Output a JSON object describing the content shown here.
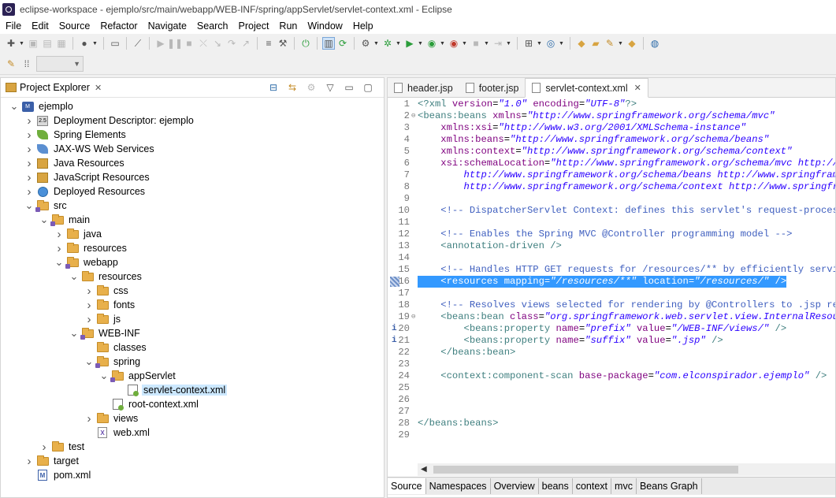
{
  "window": {
    "title": "eclipse-workspace - ejemplo/src/main/webapp/WEB-INF/spring/appServlet/servlet-context.xml - Eclipse"
  },
  "menubar": [
    "File",
    "Edit",
    "Source",
    "Refactor",
    "Navigate",
    "Search",
    "Project",
    "Run",
    "Window",
    "Help"
  ],
  "explorer": {
    "tab_label": "Project Explorer",
    "close_glyph": "✕",
    "tree": [
      {
        "label": "ejemplo",
        "depth": 0,
        "twisty": "open",
        "icon": "project"
      },
      {
        "label": "Deployment Descriptor: ejemplo",
        "depth": 1,
        "twisty": "closed",
        "icon": "dd"
      },
      {
        "label": "Spring Elements",
        "depth": 1,
        "twisty": "closed",
        "icon": "leaf"
      },
      {
        "label": "JAX-WS Web Services",
        "depth": 1,
        "twisty": "closed",
        "icon": "ws"
      },
      {
        "label": "Java Resources",
        "depth": 1,
        "twisty": "closed",
        "icon": "jar"
      },
      {
        "label": "JavaScript Resources",
        "depth": 1,
        "twisty": "closed",
        "icon": "jar"
      },
      {
        "label": "Deployed Resources",
        "depth": 1,
        "twisty": "closed",
        "icon": "globe"
      },
      {
        "label": "src",
        "depth": 1,
        "twisty": "open",
        "icon": "pkgfolder"
      },
      {
        "label": "main",
        "depth": 2,
        "twisty": "open",
        "icon": "pkgfolder"
      },
      {
        "label": "java",
        "depth": 3,
        "twisty": "closed",
        "icon": "folder"
      },
      {
        "label": "resources",
        "depth": 3,
        "twisty": "closed",
        "icon": "folder"
      },
      {
        "label": "webapp",
        "depth": 3,
        "twisty": "open",
        "icon": "pkgfolder"
      },
      {
        "label": "resources",
        "depth": 4,
        "twisty": "open",
        "icon": "folder"
      },
      {
        "label": "css",
        "depth": 5,
        "twisty": "closed",
        "icon": "folder"
      },
      {
        "label": "fonts",
        "depth": 5,
        "twisty": "closed",
        "icon": "folder"
      },
      {
        "label": "js",
        "depth": 5,
        "twisty": "closed",
        "icon": "folder"
      },
      {
        "label": "WEB-INF",
        "depth": 4,
        "twisty": "open",
        "icon": "pkgfolder"
      },
      {
        "label": "classes",
        "depth": 5,
        "twisty": "none",
        "icon": "folder"
      },
      {
        "label": "spring",
        "depth": 5,
        "twisty": "open",
        "icon": "pkgfolder"
      },
      {
        "label": "appServlet",
        "depth": 6,
        "twisty": "open",
        "icon": "pkgfolder"
      },
      {
        "label": "servlet-context.xml",
        "depth": 7,
        "twisty": "none",
        "icon": "springcfg",
        "selected": true
      },
      {
        "label": "root-context.xml",
        "depth": 6,
        "twisty": "none",
        "icon": "springcfg"
      },
      {
        "label": "views",
        "depth": 5,
        "twisty": "closed",
        "icon": "folder"
      },
      {
        "label": "web.xml",
        "depth": 5,
        "twisty": "none",
        "icon": "xml"
      },
      {
        "label": "test",
        "depth": 2,
        "twisty": "closed",
        "icon": "folder"
      },
      {
        "label": "target",
        "depth": 1,
        "twisty": "closed",
        "icon": "folder"
      },
      {
        "label": "pom.xml",
        "depth": 1,
        "twisty": "none",
        "icon": "mfile"
      }
    ]
  },
  "editor": {
    "tabs": [
      {
        "label": "header.jsp",
        "active": false
      },
      {
        "label": "footer.jsp",
        "active": false
      },
      {
        "label": "servlet-context.xml",
        "active": true
      }
    ],
    "lines": [
      {
        "n": "1",
        "fold": "",
        "tokens": [
          [
            "pi",
            "<?xml "
          ],
          [
            "attr",
            "version"
          ],
          [
            "plain",
            "="
          ],
          [
            "val",
            "\"1.0\""
          ],
          [
            "plain",
            " "
          ],
          [
            "attr",
            "encoding"
          ],
          [
            "plain",
            "="
          ],
          [
            "val",
            "\"UTF-8\""
          ],
          [
            "pi",
            "?>"
          ]
        ]
      },
      {
        "n": "2",
        "fold": "⊖",
        "tokens": [
          [
            "tag",
            "<beans:beans "
          ],
          [
            "attr",
            "xmlns"
          ],
          [
            "plain",
            "="
          ],
          [
            "val",
            "\"http://www.springframework.org/schema/mvc\""
          ]
        ]
      },
      {
        "n": "3",
        "fold": "",
        "tokens": [
          [
            "plain",
            "    "
          ],
          [
            "attr",
            "xmlns:xsi"
          ],
          [
            "plain",
            "="
          ],
          [
            "val",
            "\"http://www.w3.org/2001/XMLSchema-instance\""
          ]
        ]
      },
      {
        "n": "4",
        "fold": "",
        "tokens": [
          [
            "plain",
            "    "
          ],
          [
            "attr",
            "xmlns:beans"
          ],
          [
            "plain",
            "="
          ],
          [
            "val",
            "\"http://www.springframework.org/schema/beans\""
          ]
        ]
      },
      {
        "n": "5",
        "fold": "",
        "tokens": [
          [
            "plain",
            "    "
          ],
          [
            "attr",
            "xmlns:context"
          ],
          [
            "plain",
            "="
          ],
          [
            "val",
            "\"http://www.springframework.org/schema/context\""
          ]
        ]
      },
      {
        "n": "6",
        "fold": "",
        "tokens": [
          [
            "plain",
            "    "
          ],
          [
            "attr",
            "xsi:schemaLocation"
          ],
          [
            "plain",
            "="
          ],
          [
            "val",
            "\"http://www.springframework.org/schema/mvc http://www"
          ]
        ]
      },
      {
        "n": "7",
        "fold": "",
        "tokens": [
          [
            "plain",
            "        "
          ],
          [
            "val",
            "http://www.springframework.org/schema/beans http://www.springframewo"
          ]
        ]
      },
      {
        "n": "8",
        "fold": "",
        "tokens": [
          [
            "plain",
            "        "
          ],
          [
            "val",
            "http://www.springframework.org/schema/context http://www.springframe"
          ]
        ]
      },
      {
        "n": "9",
        "fold": "",
        "tokens": []
      },
      {
        "n": "10",
        "fold": "",
        "tokens": [
          [
            "plain",
            "    "
          ],
          [
            "com",
            "<!-- DispatcherServlet Context: defines this servlet's request-processin"
          ]
        ]
      },
      {
        "n": "11",
        "fold": "",
        "tokens": []
      },
      {
        "n": "12",
        "fold": "",
        "tokens": [
          [
            "plain",
            "    "
          ],
          [
            "com",
            "<!-- Enables the Spring MVC @Controller programming model -->"
          ]
        ]
      },
      {
        "n": "13",
        "fold": "",
        "tokens": [
          [
            "plain",
            "    "
          ],
          [
            "tag",
            "<annotation-driven />"
          ]
        ]
      },
      {
        "n": "14",
        "fold": "",
        "tokens": []
      },
      {
        "n": "15",
        "fold": "",
        "tokens": [
          [
            "plain",
            "    "
          ],
          [
            "com",
            "<!-- Handles HTTP GET requests for /resources/** by efficiently serving"
          ]
        ]
      },
      {
        "n": "16",
        "fold": "",
        "marker": "selection",
        "highlight": true,
        "tokens": [
          [
            "plain",
            "    "
          ],
          [
            "tag",
            "<resources "
          ],
          [
            "attr",
            "mapping"
          ],
          [
            "plain",
            "="
          ],
          [
            "val",
            "\"/resources/**\""
          ],
          [
            "plain",
            " "
          ],
          [
            "attr",
            "location"
          ],
          [
            "plain",
            "="
          ],
          [
            "val",
            "\"/resources/\""
          ],
          [
            "tag",
            " />"
          ]
        ]
      },
      {
        "n": "17",
        "fold": "",
        "tokens": []
      },
      {
        "n": "18",
        "fold": "",
        "tokens": [
          [
            "plain",
            "    "
          ],
          [
            "com",
            "<!-- Resolves views selected for rendering by @Controllers to .jsp resou"
          ]
        ]
      },
      {
        "n": "19",
        "fold": "⊖",
        "tokens": [
          [
            "plain",
            "    "
          ],
          [
            "tag",
            "<beans:bean "
          ],
          [
            "attr",
            "class"
          ],
          [
            "plain",
            "="
          ],
          [
            "val",
            "\"org.springframework.web.servlet.view.InternalResource"
          ]
        ]
      },
      {
        "n": "20",
        "fold": "",
        "marker": "info",
        "tokens": [
          [
            "plain",
            "        "
          ],
          [
            "tag",
            "<beans:property "
          ],
          [
            "attr",
            "name"
          ],
          [
            "plain",
            "="
          ],
          [
            "val",
            "\"prefix\""
          ],
          [
            "plain",
            " "
          ],
          [
            "attr",
            "value"
          ],
          [
            "plain",
            "="
          ],
          [
            "val",
            "\"/WEB-INF/views/\""
          ],
          [
            "tag",
            " />"
          ]
        ]
      },
      {
        "n": "21",
        "fold": "",
        "marker": "info",
        "tokens": [
          [
            "plain",
            "        "
          ],
          [
            "tag",
            "<beans:property "
          ],
          [
            "attr",
            "name"
          ],
          [
            "plain",
            "="
          ],
          [
            "val",
            "\"suffix\""
          ],
          [
            "plain",
            " "
          ],
          [
            "attr",
            "value"
          ],
          [
            "plain",
            "="
          ],
          [
            "val",
            "\".jsp\""
          ],
          [
            "tag",
            " />"
          ]
        ]
      },
      {
        "n": "22",
        "fold": "",
        "tokens": [
          [
            "plain",
            "    "
          ],
          [
            "tag",
            "</beans:bean>"
          ]
        ]
      },
      {
        "n": "23",
        "fold": "",
        "tokens": []
      },
      {
        "n": "24",
        "fold": "",
        "tokens": [
          [
            "plain",
            "    "
          ],
          [
            "tag",
            "<context:component-scan "
          ],
          [
            "attr",
            "base-package"
          ],
          [
            "plain",
            "="
          ],
          [
            "val",
            "\"com.elconspirador.ejemplo\""
          ],
          [
            "tag",
            " />"
          ]
        ]
      },
      {
        "n": "25",
        "fold": "",
        "tokens": []
      },
      {
        "n": "26",
        "fold": "",
        "tokens": []
      },
      {
        "n": "27",
        "fold": "",
        "tokens": []
      },
      {
        "n": "28",
        "fold": "",
        "tokens": [
          [
            "tag",
            "</beans:beans>"
          ]
        ]
      },
      {
        "n": "29",
        "fold": "",
        "tokens": []
      }
    ],
    "bottom_tabs": [
      {
        "label": "Source",
        "active": true
      },
      {
        "label": "Namespaces",
        "active": false
      },
      {
        "label": "Overview",
        "active": false
      },
      {
        "label": "beans",
        "active": false
      },
      {
        "label": "context",
        "active": false
      },
      {
        "label": "mvc",
        "active": false
      },
      {
        "label": "Beans Graph",
        "active": false
      }
    ]
  }
}
